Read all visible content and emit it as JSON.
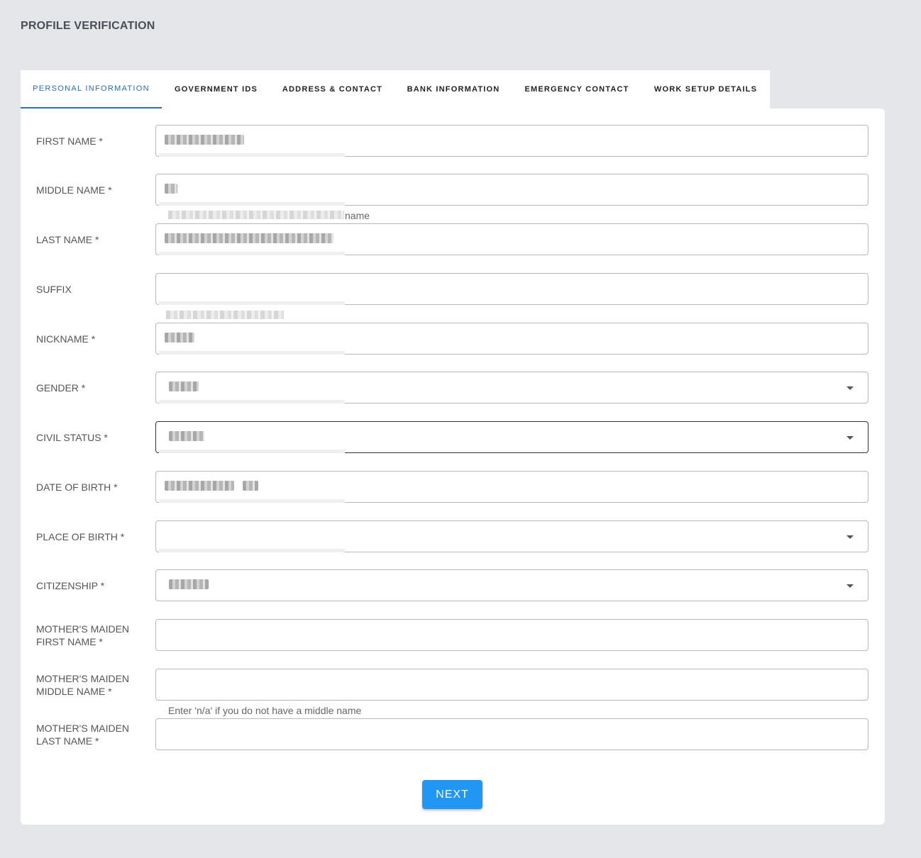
{
  "page_title": "PROFILE VERIFICATION",
  "tabs": [
    {
      "label": "PERSONAL INFORMATION",
      "active": true
    },
    {
      "label": "GOVERNMENT IDS",
      "active": false
    },
    {
      "label": "ADDRESS & CONTACT",
      "active": false
    },
    {
      "label": "BANK INFORMATION",
      "active": false
    },
    {
      "label": "EMERGENCY CONTACT",
      "active": false
    },
    {
      "label": "WORK SETUP DETAILS",
      "active": false
    }
  ],
  "form": {
    "first_name": {
      "label": "FIRST NAME *",
      "value": "[redacted]"
    },
    "middle_name": {
      "label": "MIDDLE NAME *",
      "value": "[redacted]",
      "hint": "name"
    },
    "last_name": {
      "label": "LAST NAME *",
      "value": "[redacted]"
    },
    "suffix": {
      "label": "SUFFIX",
      "value": ""
    },
    "nickname": {
      "label": "NICKNAME *",
      "value": "[redacted]"
    },
    "gender": {
      "label": "GENDER *",
      "value": "[redacted]"
    },
    "civil_status": {
      "label": "CIVIL STATUS *",
      "value": "[redacted]"
    },
    "date_of_birth": {
      "label": "DATE OF BIRTH *",
      "value": "[redacted]"
    },
    "place_of_birth": {
      "label": "PLACE OF BIRTH *",
      "value": ""
    },
    "citizenship": {
      "label": "CITIZENSHIP *",
      "value": "[redacted]"
    },
    "mother_maiden_first": {
      "label_line1": "MOTHER'S MAIDEN",
      "label_line2": "FIRST NAME *",
      "value": ""
    },
    "mother_maiden_middle": {
      "label_line1": "MOTHER'S MAIDEN",
      "label_line2": "MIDDLE NAME *",
      "value": "",
      "hint": "Enter 'n/a' if you do not have a middle name"
    },
    "mother_maiden_last": {
      "label_line1": "MOTHER'S MAIDEN",
      "label_line2": "LAST NAME *",
      "value": ""
    }
  },
  "next_label": "NEXT",
  "colors": {
    "accent": "#2196f3",
    "tab_active": "#2a6fb5",
    "background": "#e4e6ea"
  }
}
